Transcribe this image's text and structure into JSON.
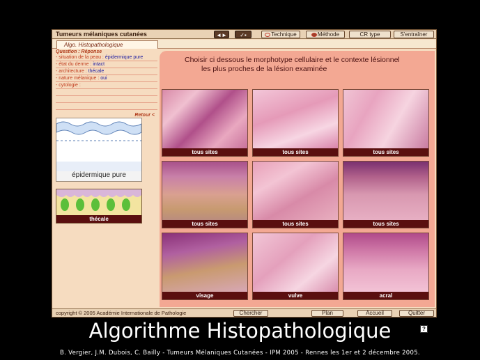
{
  "app": {
    "title": "Tumeurs mélaniques cutanées",
    "toolbar": {
      "nav_icon": "arrows-icon",
      "check_icon": "check-grid-icon",
      "technique": "Technique",
      "methode": "Méthode",
      "cr_type": "CR type",
      "entrainer": "S'entraîner"
    },
    "tab": "Algo. Histopathologique"
  },
  "left": {
    "question_header": "Question : Réponse",
    "rows": [
      {
        "q": "- situation de la peau :",
        "a": "épidermique pure"
      },
      {
        "q": "- état du derme :",
        "a": "intact"
      },
      {
        "q": "- architecture :",
        "a": "thécale"
      },
      {
        "q": "- nature mélanique :",
        "a": "oui"
      },
      {
        "q": "- cytologie :",
        "a": ""
      },
      {
        "q": "",
        "a": ""
      },
      {
        "q": "",
        "a": ""
      },
      {
        "q": "",
        "a": ""
      }
    ],
    "retour": "Retour <",
    "thumb_epi_label": "épidermique pure",
    "thumb_thec_label": "thécale"
  },
  "main": {
    "instruction_line1": "Choisir  ci dessous le morphotype cellulaire et le contexte lésionnel",
    "instruction_line2": "les plus proches de la lésion examinée",
    "tiles": [
      {
        "label": "tous sites"
      },
      {
        "label": "tous sites"
      },
      {
        "label": "tous sites"
      },
      {
        "label": "tous sites"
      },
      {
        "label": "tous sites"
      },
      {
        "label": "tous sites"
      },
      {
        "label": "visage"
      },
      {
        "label": "vulve"
      },
      {
        "label": "acral"
      }
    ],
    "help": "?"
  },
  "footer": {
    "copyright": "copyright © 2005 Académie Internationale de Pathologie",
    "chercher": "Chercher",
    "plan": "Plan",
    "accueil": "Accueil",
    "quitter": "Quitter"
  },
  "slide": {
    "title": "Algorithme Histopathologique",
    "credit": "B. Vergier, J.M. Dubois, C. Bailly - Tumeurs Mélaniques Cutanées - IPM 2005 - Rennes les 1er et 2 décembre 2005."
  },
  "colors": {
    "panel_bg": "#f6dcc0",
    "main_bg": "#f3a893",
    "label_bar": "#5a0f0f",
    "answer_text": "#1a1aa0",
    "question_text": "#c0391b"
  }
}
